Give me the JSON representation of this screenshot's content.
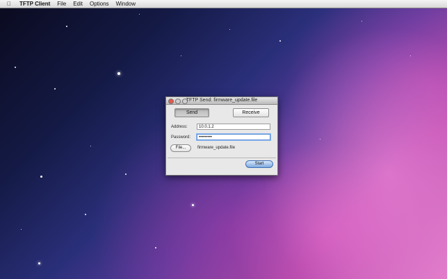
{
  "menubar": {
    "app_name": "TFTP Client",
    "items": [
      "File",
      "Edit",
      "Options",
      "Window"
    ]
  },
  "window": {
    "title": "TFTP Send: firmware_update.file",
    "send_label": "Send",
    "receive_label": "Receive",
    "address_label": "Address:",
    "address_value": "10.0.1.2",
    "password_label": "Password:",
    "password_value": "•••••••••",
    "file_button_label": "File...",
    "file_name": "firmware_update.file",
    "start_label": "Start"
  },
  "colors": {
    "close_button": "#e25a4d",
    "default_button": "#7ea8df",
    "focus_ring": "#5a8fd8"
  }
}
